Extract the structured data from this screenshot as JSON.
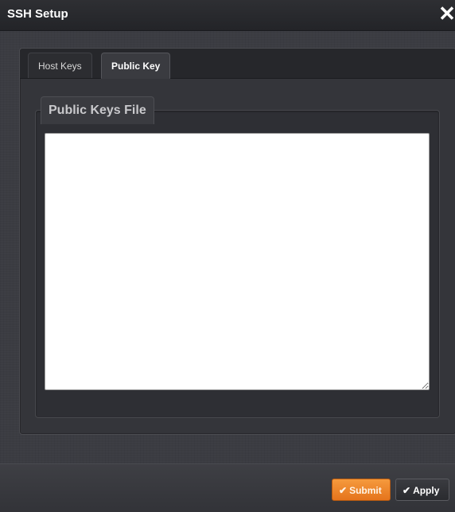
{
  "window": {
    "title": "SSH Setup",
    "close_glyph": "✕"
  },
  "tabs": [
    {
      "label": "Host Keys",
      "active": false
    },
    {
      "label": "Public Key",
      "active": true
    }
  ],
  "public_key": {
    "legend": "Public Keys File",
    "textarea_value": ""
  },
  "footer": {
    "submit_label": "Submit",
    "apply_label": "Apply",
    "check_glyph": "✔"
  },
  "colors": {
    "submit_accent": "#f08a2c",
    "background": "#3a3b40"
  }
}
